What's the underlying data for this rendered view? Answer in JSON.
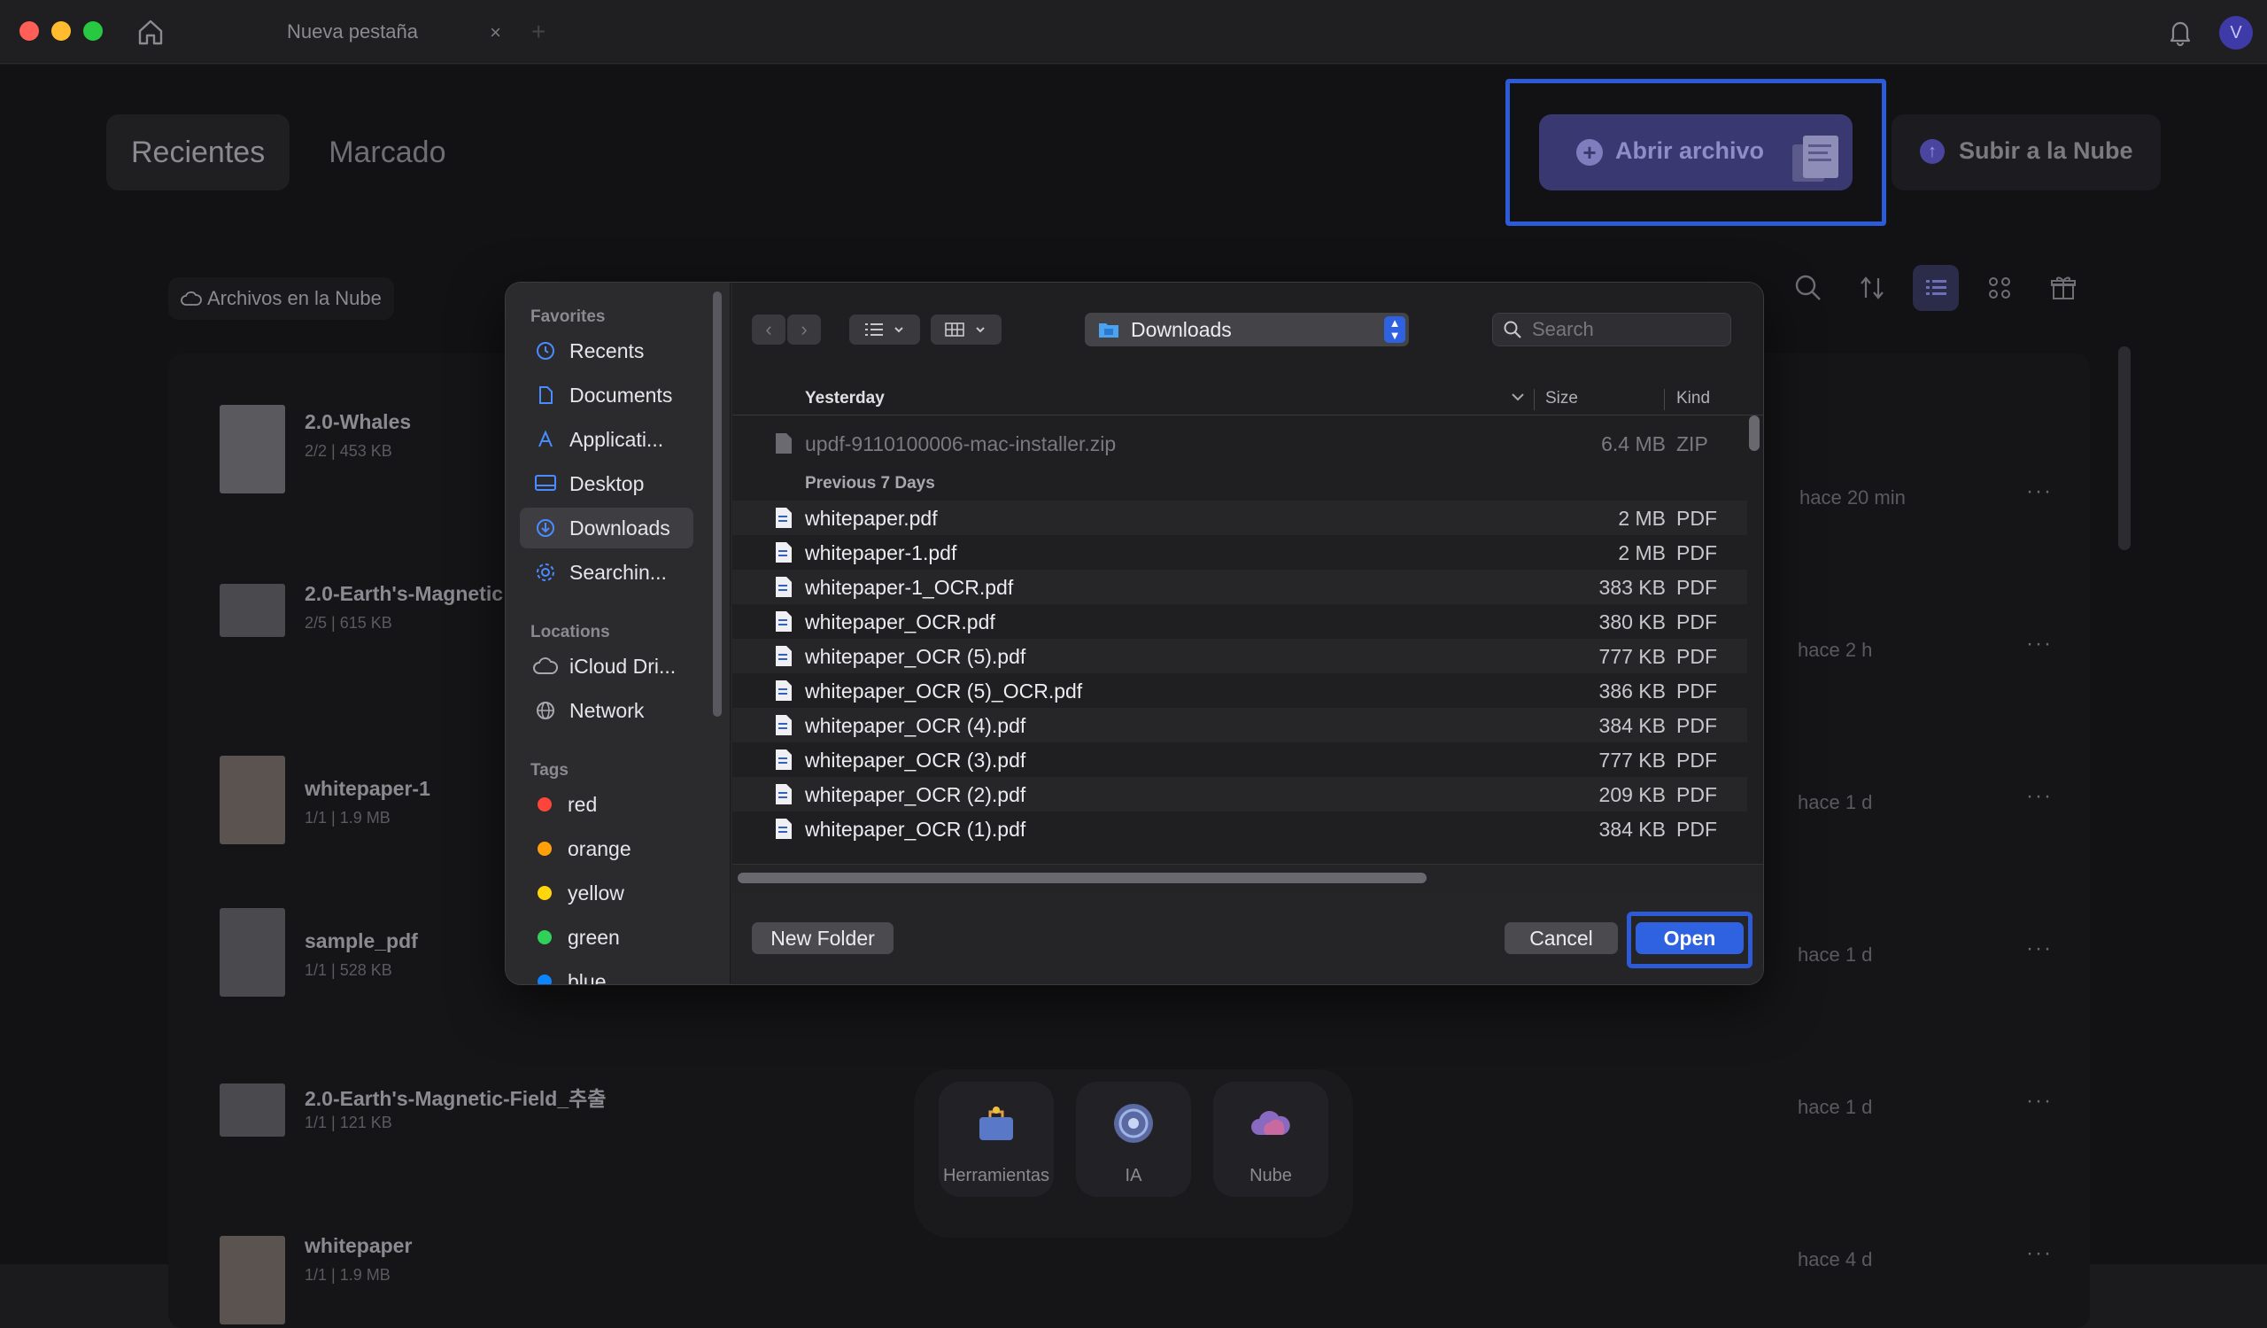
{
  "titlebar": {
    "tab_title": "Nueva pestaña",
    "tab_close": "×",
    "tab_add": "+",
    "avatar_initial": "V"
  },
  "header": {
    "tabs": [
      {
        "label": "Recientes",
        "active": true
      },
      {
        "label": "Marcado",
        "active": false
      }
    ],
    "open_file_label": "Abrir archivo",
    "upload_cloud_label": "Subir a la Nube",
    "cloud_files_label": "Archivos en la Nube"
  },
  "recent_files": [
    {
      "name": "2.0-Whales",
      "meta": "2/2 | 453 KB",
      "time": "hace 20 min"
    },
    {
      "name": "2.0-Earth's-Magnetic",
      "meta": "2/5 | 615 KB",
      "time": "hace 2 h"
    },
    {
      "name": "whitepaper-1",
      "meta": "1/1 | 1.9 MB",
      "time": "hace 1 d"
    },
    {
      "name": "sample_pdf",
      "meta": "1/1 | 528 KB",
      "time": "hace 1 d"
    },
    {
      "name": "2.0-Earth's-Magnetic-Field_추출",
      "meta": "1/1 | 121 KB",
      "time": "hace 1 d"
    },
    {
      "name": "whitepaper",
      "meta": "1/1 | 1.9 MB",
      "time": "hace 4 d"
    }
  ],
  "dock": {
    "items": [
      {
        "label": "Herramientas",
        "icon": "tools-icon"
      },
      {
        "label": "IA",
        "icon": "ai-icon"
      },
      {
        "label": "Nube",
        "icon": "cloud-icon"
      }
    ]
  },
  "dialog": {
    "sidebar": {
      "favorites_title": "Favorites",
      "favorites": [
        {
          "label": "Recents",
          "icon": "clock-icon"
        },
        {
          "label": "Documents",
          "icon": "document-icon"
        },
        {
          "label": "Applicati...",
          "icon": "applications-icon"
        },
        {
          "label": "Desktop",
          "icon": "desktop-icon"
        },
        {
          "label": "Downloads",
          "icon": "download-icon",
          "active": true
        },
        {
          "label": "Searchin...",
          "icon": "gear-icon"
        }
      ],
      "locations_title": "Locations",
      "locations": [
        {
          "label": "iCloud Dri...",
          "icon": "icloud-icon"
        },
        {
          "label": "Network",
          "icon": "globe-icon"
        }
      ],
      "tags_title": "Tags",
      "tags": [
        {
          "label": "red",
          "color": "#ff453a"
        },
        {
          "label": "orange",
          "color": "#ff9f0a"
        },
        {
          "label": "yellow",
          "color": "#ffd60a"
        },
        {
          "label": "green",
          "color": "#30d158"
        },
        {
          "label": "blue",
          "color": "#0a84ff"
        }
      ]
    },
    "location": "Downloads",
    "search_placeholder": "Search",
    "columns": {
      "name": "Yesterday",
      "size": "Size",
      "kind": "Kind"
    },
    "yesterday_files": [
      {
        "name": "updf-9110100006-mac-installer.zip",
        "size": "6.4 MB",
        "kind": "ZIP"
      }
    ],
    "previous_label": "Previous 7 Days",
    "previous_files": [
      {
        "name": "whitepaper.pdf",
        "size": "2 MB",
        "kind": "PDF"
      },
      {
        "name": "whitepaper-1.pdf",
        "size": "2 MB",
        "kind": "PDF"
      },
      {
        "name": "whitepaper-1_OCR.pdf",
        "size": "383 KB",
        "kind": "PDF"
      },
      {
        "name": "whitepaper_OCR.pdf",
        "size": "380 KB",
        "kind": "PDF"
      },
      {
        "name": "whitepaper_OCR (5).pdf",
        "size": "777 KB",
        "kind": "PDF"
      },
      {
        "name": "whitepaper_OCR (5)_OCR.pdf",
        "size": "386 KB",
        "kind": "PDF"
      },
      {
        "name": "whitepaper_OCR (4).pdf",
        "size": "384 KB",
        "kind": "PDF"
      },
      {
        "name": "whitepaper_OCR (3).pdf",
        "size": "777 KB",
        "kind": "PDF"
      },
      {
        "name": "whitepaper_OCR (2).pdf",
        "size": "209 KB",
        "kind": "PDF"
      },
      {
        "name": "whitepaper_OCR (1).pdf",
        "size": "384 KB",
        "kind": "PDF"
      }
    ],
    "buttons": {
      "new_folder": "New Folder",
      "cancel": "Cancel",
      "open": "Open"
    }
  }
}
